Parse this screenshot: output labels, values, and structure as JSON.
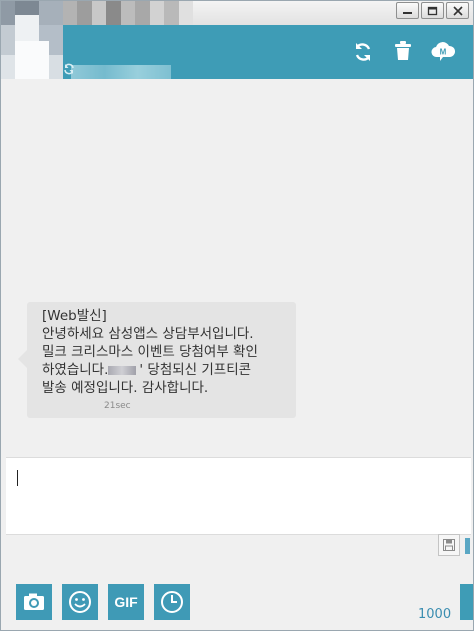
{
  "window": {
    "buttons": [
      "minimize",
      "maximize",
      "close"
    ]
  },
  "header": {
    "accent_color": "#3e9cb6",
    "actions": [
      {
        "name": "refresh",
        "icon": "refresh-icon"
      },
      {
        "name": "delete",
        "icon": "trash-icon"
      },
      {
        "name": "memo",
        "icon": "cloud-m-icon"
      }
    ],
    "memo_icon_letter": "M"
  },
  "message": {
    "line1": "[Web발신]",
    "line2": "안녕하세요 삼성앱스 상담부서입니다.",
    "line3": "밀크 크리스마스 이벤트 당첨여부 확인",
    "line4_pre": "하였습니다.",
    "line4_post": "' 당첨되신 기프티콘",
    "line5": "발송 예정입니다. 감사합니다.",
    "time": "21sec"
  },
  "toolbar": {
    "camera_icon": "camera-icon",
    "emoji_icon": "smiley-icon",
    "gif_label": "GIF",
    "schedule_icon": "clock-icon"
  },
  "composer": {
    "char_count": "1000"
  }
}
